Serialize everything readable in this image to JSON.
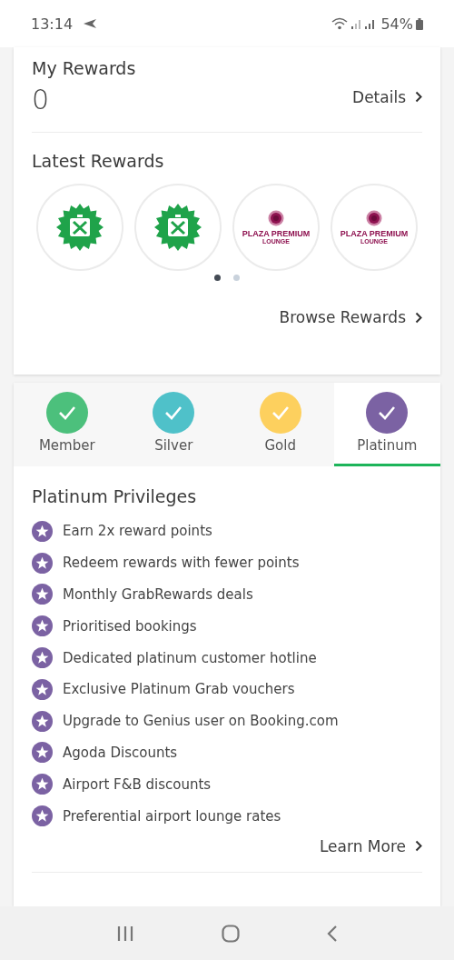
{
  "status_bar": {
    "time": "13:14",
    "battery": "54%"
  },
  "my_rewards": {
    "title": "My Rewards",
    "points": "0",
    "details_link": "Details"
  },
  "latest_rewards": {
    "title": "Latest Rewards",
    "items": [
      {
        "kind": "food"
      },
      {
        "kind": "food"
      },
      {
        "kind": "lounge",
        "brand": "PLAZA PREMIUM",
        "subtitle": "LOUNGE"
      },
      {
        "kind": "lounge",
        "brand": "PLAZA PREMIUM",
        "subtitle": "LOUNGE"
      }
    ],
    "pages": [
      {
        "selected": true
      },
      {
        "selected": false
      }
    ],
    "browse_link": "Browse Rewards"
  },
  "tiers": [
    {
      "label": "Member",
      "color": "#4cc07c",
      "selected": false
    },
    {
      "label": "Silver",
      "color": "#4fc1c9",
      "selected": false
    },
    {
      "label": "Gold",
      "color": "#fdd05e",
      "selected": false
    },
    {
      "label": "Platinum",
      "color": "#7b62a3",
      "selected": true
    }
  ],
  "privileges": {
    "title": "Platinum Privileges",
    "items": [
      "Earn 2x reward points",
      "Redeem rewards with fewer points",
      "Monthly GrabRewards deals",
      "Prioritised bookings",
      "Dedicated platinum customer hotline",
      "Exclusive Platinum Grab vouchers",
      "Upgrade to Genius user on Booking.com",
      "Agoda Discounts",
      "Airport F&B discounts",
      "Preferential airport lounge rates"
    ],
    "learn_more": "Learn More"
  }
}
